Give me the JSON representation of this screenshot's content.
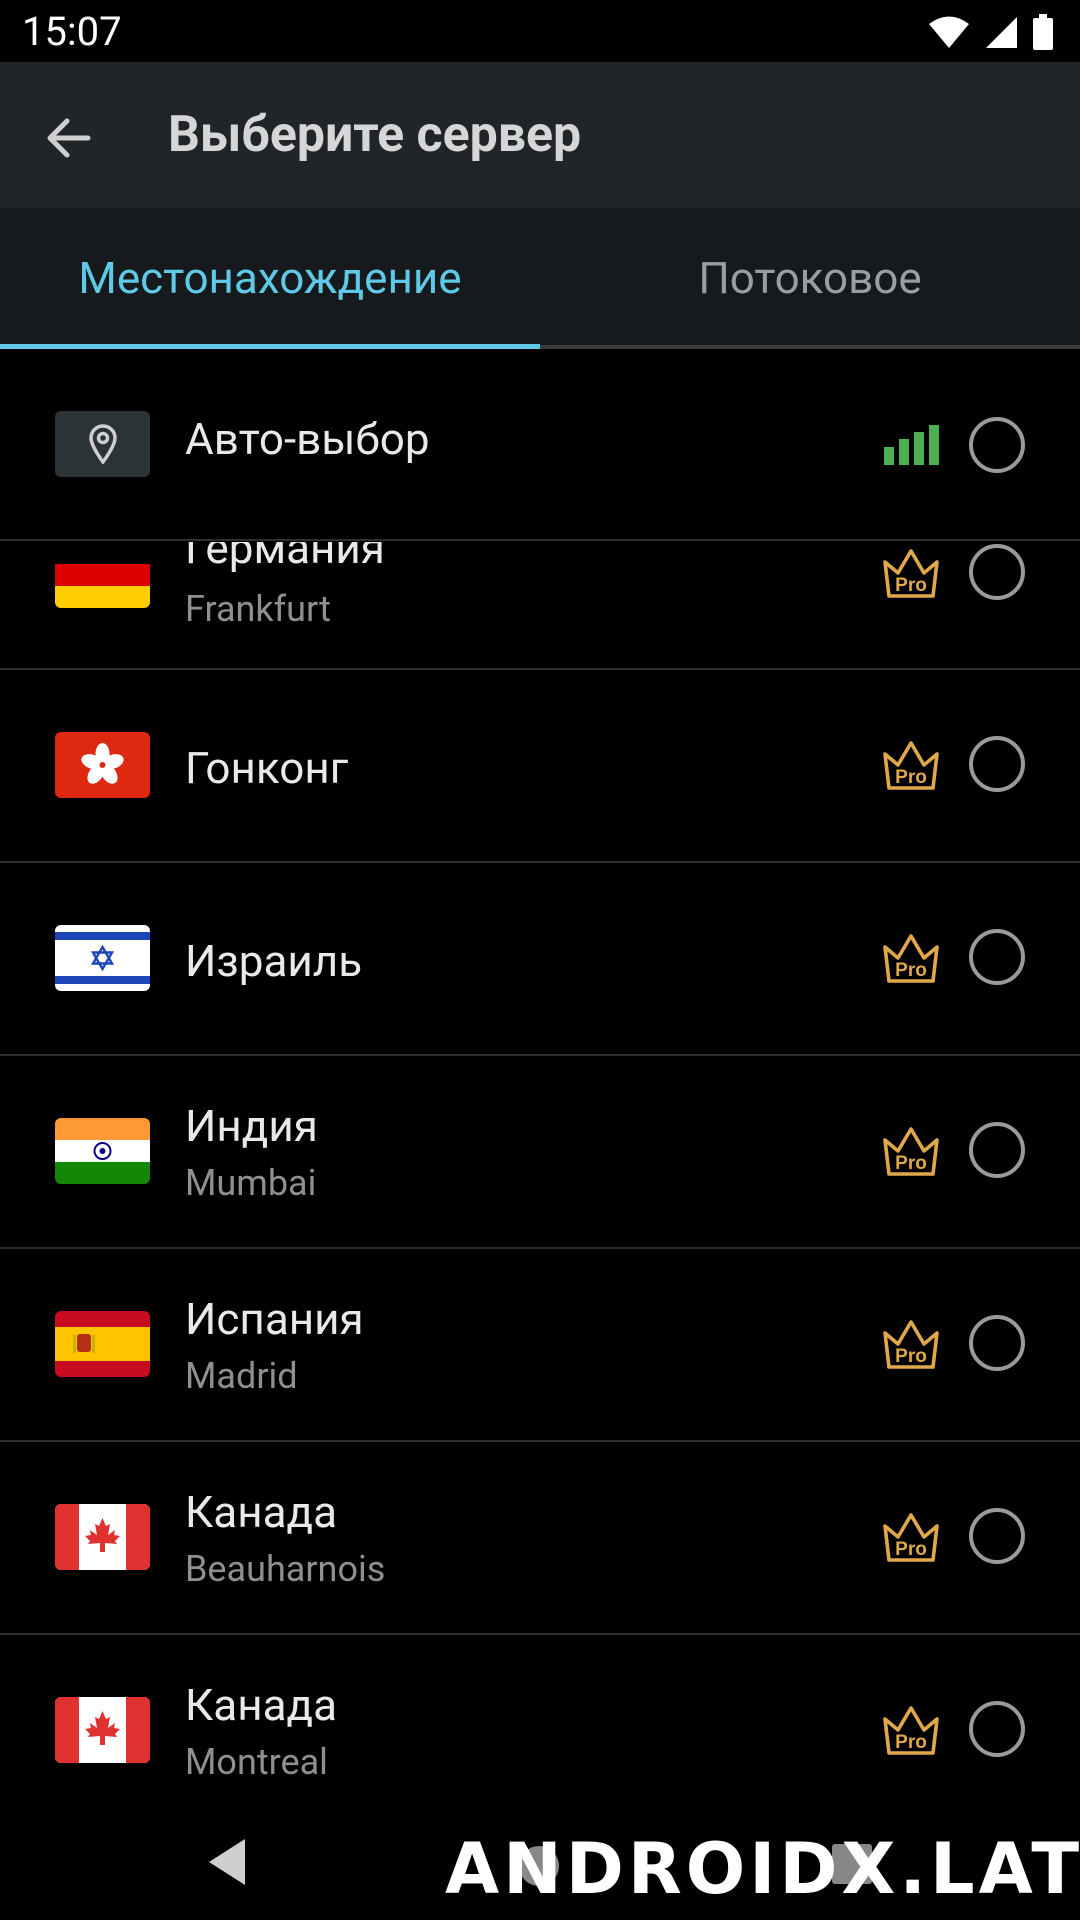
{
  "status_bar": {
    "time": "15:07"
  },
  "app_bar": {
    "title": "Выберите сервер"
  },
  "tabs": [
    {
      "label": "Местонахождение",
      "active": true
    },
    {
      "label": "Потоковое",
      "active": false
    }
  ],
  "auto_select": {
    "label": "Авто-выбор",
    "icon": "location-pin-icon",
    "signal_color": "#4caf50"
  },
  "servers": [
    {
      "country": "Германия",
      "city": "Frankfurt",
      "flag": "flag-germany",
      "pro": true
    },
    {
      "country": "Гонконг",
      "city": "",
      "flag": "flag-hong-kong",
      "pro": true
    },
    {
      "country": "Израиль",
      "city": "",
      "flag": "flag-israel",
      "pro": true
    },
    {
      "country": "Индия",
      "city": "Mumbai",
      "flag": "flag-india",
      "pro": true
    },
    {
      "country": "Испания",
      "city": "Madrid",
      "flag": "flag-spain",
      "pro": true
    },
    {
      "country": "Канада",
      "city": "Beauharnois",
      "flag": "flag-canada",
      "pro": true
    },
    {
      "country": "Канада",
      "city": "Montreal",
      "flag": "flag-canada",
      "pro": true
    }
  ],
  "pro_badge": {
    "label": "Pro",
    "color": "#e0a84a"
  },
  "accent_color": "#5fc9e8",
  "watermark": "ANDROIDX.LAT"
}
